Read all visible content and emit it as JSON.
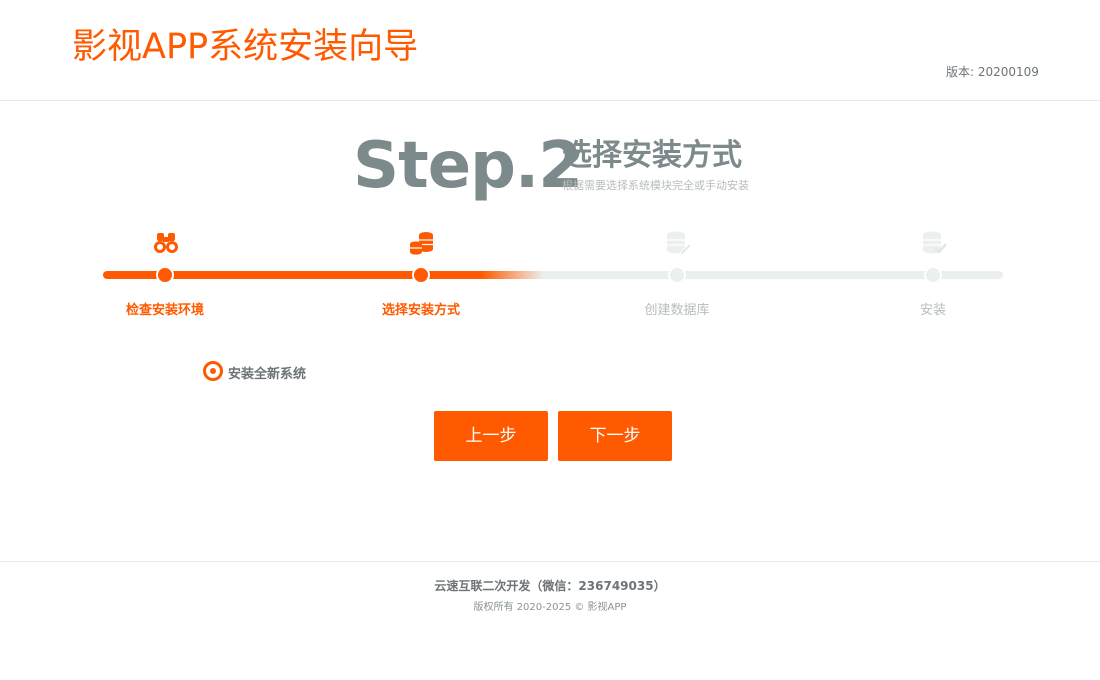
{
  "header": {
    "title": "影视APP系统安装向导",
    "version_text": "版本: 20200109"
  },
  "step": {
    "number": "Step.2",
    "name": "选择安装方式",
    "description": "根据需要选择系统模块完全或手动安装"
  },
  "progress": {
    "nodes": [
      {
        "label": "检查安装环境",
        "icon": "binoculars-icon",
        "state": "done"
      },
      {
        "label": "选择安装方式",
        "icon": "coins-icon",
        "state": "done"
      },
      {
        "label": "创建数据库",
        "icon": "database-edit-icon",
        "state": "todo"
      },
      {
        "label": "安装",
        "icon": "database-check-icon",
        "state": "todo"
      }
    ]
  },
  "install_option": {
    "label": "安装全新系统",
    "selected": true
  },
  "buttons": {
    "prev_label": "上一步",
    "next_label": "下一步"
  },
  "colors": {
    "accent": "#ff5a00",
    "muted": "#7d8a8c",
    "inactive": "#ecefef"
  },
  "footer": {
    "line1": "云速互联二次开发（微信：236749035）",
    "line2": "版权所有 2020-2025 © 影视APP"
  }
}
